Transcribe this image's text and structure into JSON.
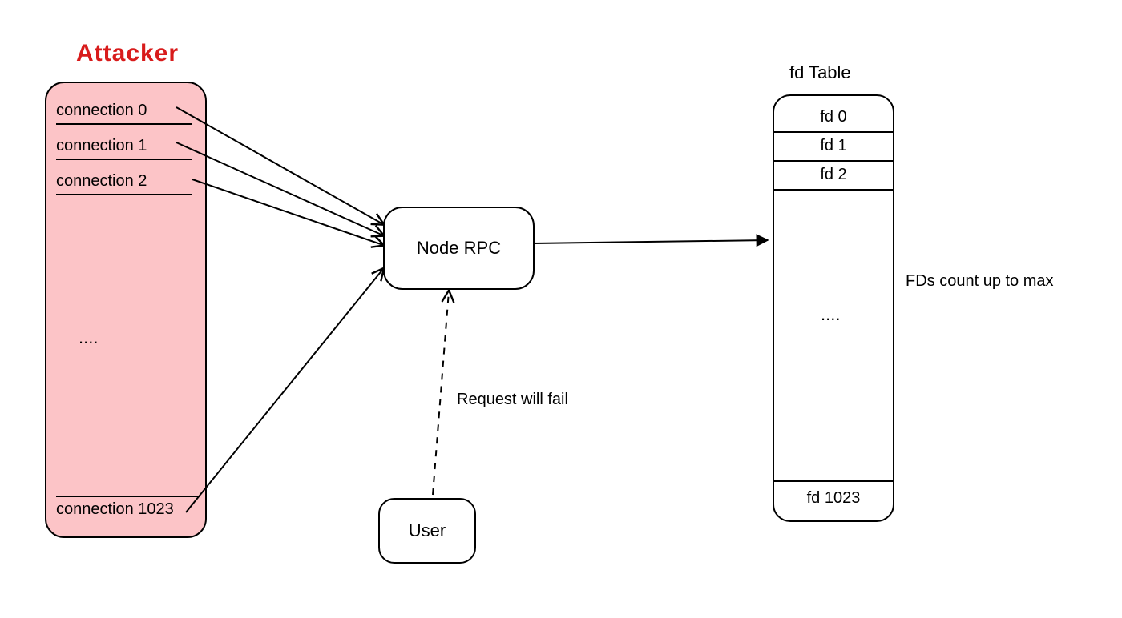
{
  "attacker": {
    "title": "Attacker",
    "connections": [
      "connection 0",
      "connection 1",
      "connection 2"
    ],
    "ellipsis": "....",
    "last_connection": "connection 1023"
  },
  "node": {
    "label": "Node RPC"
  },
  "user": {
    "label": "User"
  },
  "fd_table": {
    "title": "fd Table",
    "rows": [
      "fd 0",
      "fd 1",
      "fd 2"
    ],
    "ellipsis": "....",
    "last_row": "fd 1023"
  },
  "annotations": {
    "request_fail": "Request will fail",
    "fd_max": "FDs count up to max"
  }
}
